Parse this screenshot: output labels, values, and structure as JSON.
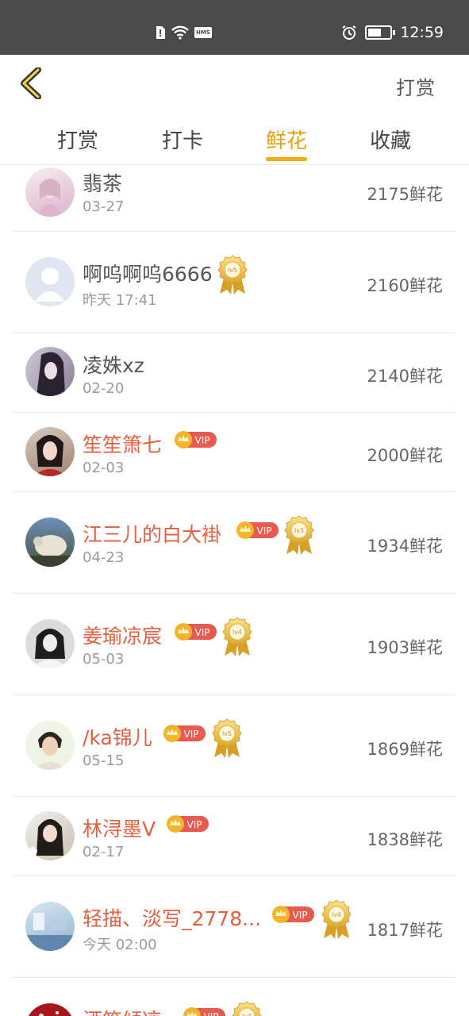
{
  "status_bar": {
    "time": "12:59",
    "hms_label": "HMS"
  },
  "header": {
    "back_icon": "chevron-left-icon",
    "right_action": "打赏"
  },
  "tabs": [
    {
      "label": "打赏",
      "active": false
    },
    {
      "label": "打卡",
      "active": false
    },
    {
      "label": "鲜花",
      "active": true
    },
    {
      "label": "收藏",
      "active": false
    }
  ],
  "colors": {
    "accent": "#f0ad17",
    "vip_name": "#e06040",
    "vip_badge": "#e65a4f",
    "status_bar": "#4a4a4a"
  },
  "vip_label": "VIP",
  "list": [
    {
      "name": "翡茶",
      "date": "03-27",
      "amount": "2175鲜花",
      "vip": false,
      "level": "",
      "avatar": "anime-girl"
    },
    {
      "name": "啊呜啊呜6666",
      "date": "昨天 17:41",
      "amount": "2160鲜花",
      "vip": false,
      "level": "lv5",
      "avatar": "default-user"
    },
    {
      "name": "凌姝xz",
      "date": "02-20",
      "amount": "2140鲜花",
      "vip": false,
      "level": "",
      "avatar": "dark-hair"
    },
    {
      "name": "笙笙箫七",
      "date": "02-03",
      "amount": "2000鲜花",
      "vip": true,
      "level": "",
      "avatar": "costume-girl"
    },
    {
      "name": "江三儿的白大褂",
      "date": "04-23",
      "amount": "1934鲜花",
      "vip": true,
      "level": "lv3",
      "avatar": "sheep"
    },
    {
      "name": "姜瑜凉宸",
      "date": "05-03",
      "amount": "1903鲜花",
      "vip": true,
      "level": "lv4",
      "avatar": "bw-girl"
    },
    {
      "name": "/ka锦儿",
      "date": "05-15",
      "amount": "1869鲜花",
      "vip": true,
      "level": "lv5",
      "avatar": "short-hair"
    },
    {
      "name": "林浔墨V",
      "date": "02-17",
      "amount": "1838鲜花",
      "vip": true,
      "level": "",
      "avatar": "photo-girl"
    },
    {
      "name": "轻描、淡写_2778...",
      "date": "今天 02:00",
      "amount": "1817鲜花",
      "vip": true,
      "level": "lv4",
      "avatar": "blue-scene"
    },
    {
      "name": "洒笑倾凉",
      "date": "",
      "amount": "",
      "vip": true,
      "level": "lv4",
      "avatar": "red-flower"
    }
  ]
}
